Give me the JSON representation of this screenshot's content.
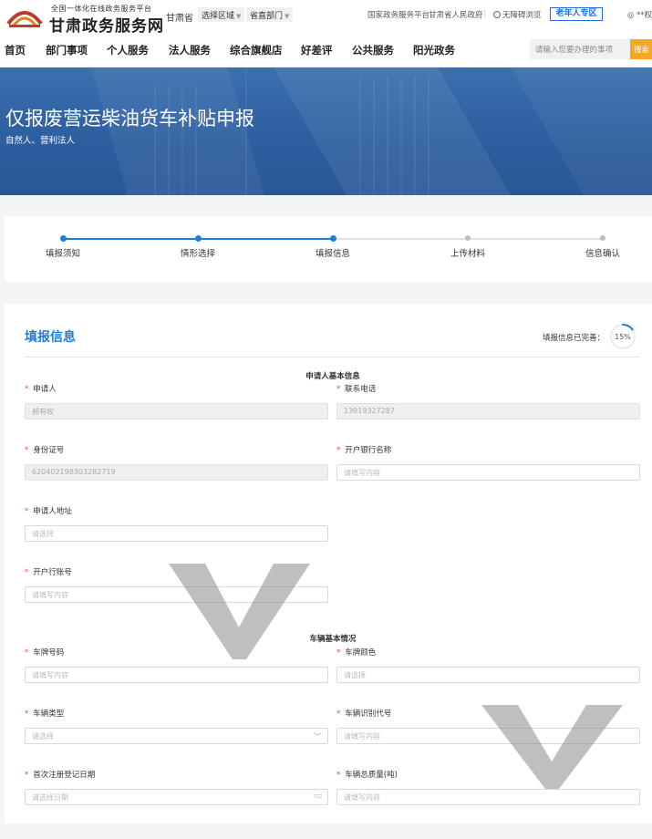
{
  "header": {
    "logo_tagline": "全国一体化在线政务服务平台",
    "logo_title": "甘肃政务服务网",
    "province": "甘肃省",
    "region_select": "选择区域",
    "dept_select": "省直部门",
    "links": [
      "国家政务服务平台",
      "甘肃省人民政府",
      "无障碍浏览"
    ],
    "elder_button": "老年人专区",
    "user": "**权"
  },
  "nav": {
    "items": [
      "首页",
      "部门事项",
      "个人服务",
      "法人服务",
      "综合旗舰店",
      "好差评",
      "公共服务",
      "阳光政务"
    ],
    "search_placeholder": "请输入您要办理的事项",
    "search_button": "搜索"
  },
  "banner": {
    "title": "仅报废营运柴油货车补贴申报",
    "subtitle": "自然人、营利法人"
  },
  "steps": {
    "items": [
      "填报须知",
      "情形选择",
      "填报信息",
      "上传材料",
      "信息确认"
    ],
    "current_index": 2
  },
  "form": {
    "title": "填报信息",
    "progress_label": "填报信息已完善：",
    "progress_text": "15%",
    "progress_value": 0.15,
    "sections": [
      {
        "title": "申请人基本信息",
        "fields": [
          {
            "label": "申请人",
            "value": "郝有权",
            "placeholder": "",
            "disabled": true
          },
          {
            "label": "联系电话",
            "value": "13919327287",
            "placeholder": "",
            "disabled": true
          },
          {
            "label": "身份证号",
            "value": "620402198303282719",
            "placeholder": "",
            "disabled": true
          },
          {
            "label": "开户银行名称",
            "value": "",
            "placeholder": "请填写内容",
            "disabled": false
          },
          {
            "label": "申请人地址",
            "value": "",
            "placeholder": "请选择",
            "disabled": false
          },
          {
            "label": "开户行账号",
            "value": "",
            "placeholder": "请填写内容",
            "disabled": false
          }
        ]
      },
      {
        "title": "车辆基本情况",
        "fields": [
          {
            "label": "车牌号码",
            "value": "",
            "placeholder": "请填写内容"
          },
          {
            "label": "车牌颜色",
            "value": "",
            "placeholder": "请选择"
          },
          {
            "label": "车辆类型",
            "value": "",
            "placeholder": "请选择",
            "suffix_icon": "chevron-down-icon"
          },
          {
            "label": "车辆识别代号",
            "value": "",
            "placeholder": "请填写内容"
          },
          {
            "label": "首次注册登记日期",
            "value": "",
            "placeholder": "请选择日期",
            "suffix_icon": "calendar-icon"
          },
          {
            "label": "车辆总质量(吨)",
            "value": "",
            "placeholder": "请填写内容"
          }
        ]
      }
    ]
  },
  "colors": {
    "accent": "#1e7fd9",
    "banner": "#2d5e9f",
    "required": "#e5484d",
    "search_button": "#f5a623"
  }
}
